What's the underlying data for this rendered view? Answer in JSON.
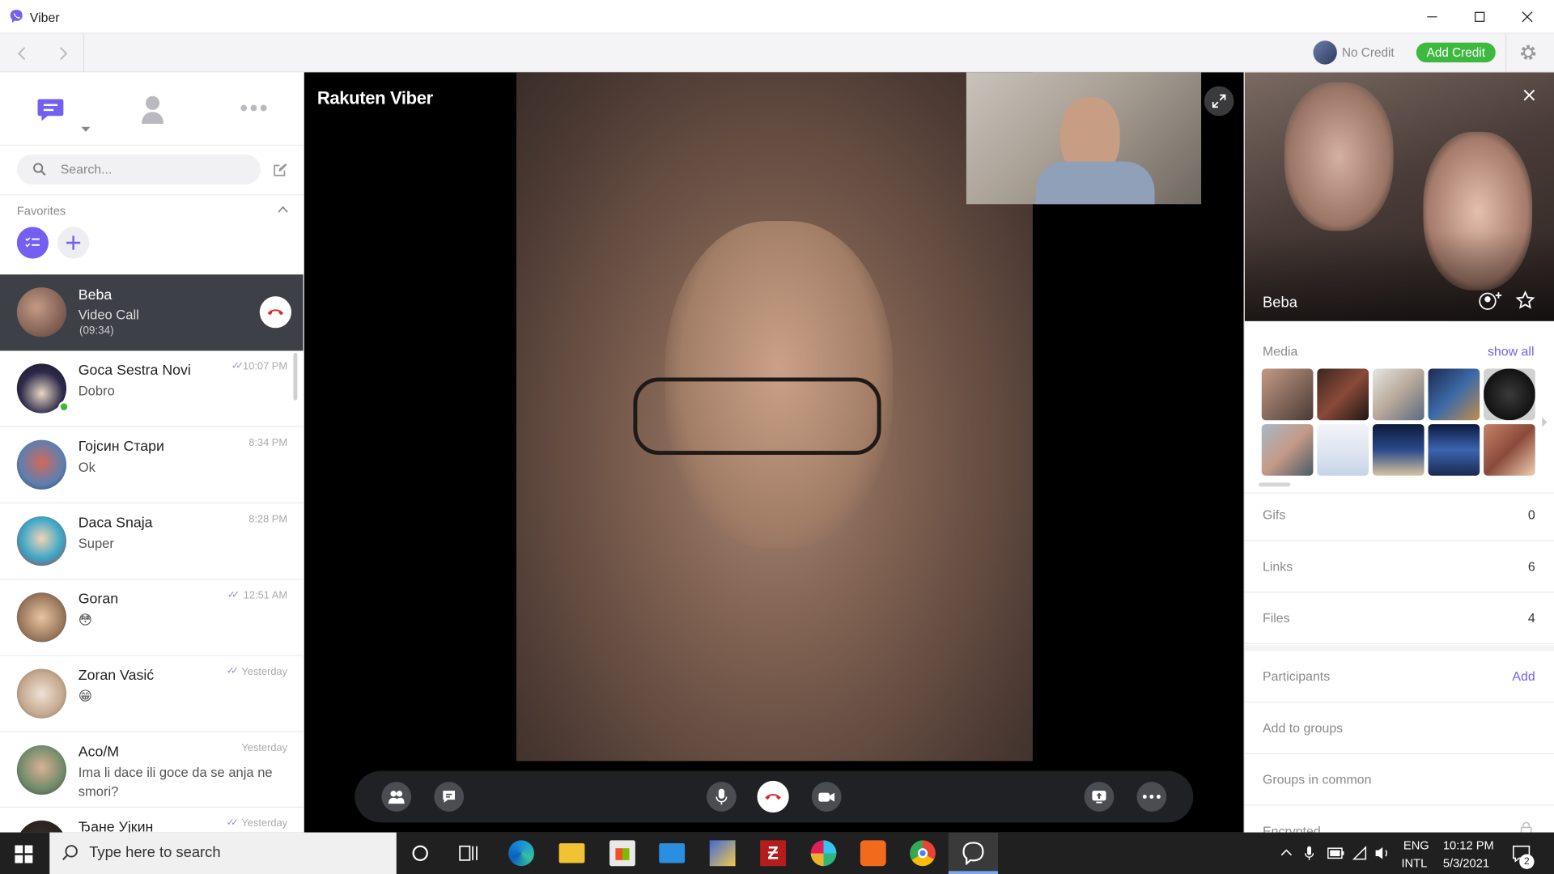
{
  "window": {
    "title": "Viber"
  },
  "toolbar": {
    "credit_status": "No Credit",
    "add_credit_label": "Add Credit"
  },
  "left": {
    "search_placeholder": "Search...",
    "favorites_label": "Favorites",
    "chats": [
      {
        "name": "Beba",
        "msg": "Video Call",
        "msg2": "(09:34)",
        "time": "",
        "active": true
      },
      {
        "name": "Goca Sestra Novi",
        "msg": "Dobro",
        "time": "10:07 PM",
        "online": true,
        "ticks": true
      },
      {
        "name": "Гојсин Стари",
        "msg": "Ok",
        "time": "8:34 PM"
      },
      {
        "name": "Daca Snaja",
        "msg": "Super",
        "time": "8:28 PM"
      },
      {
        "name": "Goran",
        "msg": "😳",
        "time": "12:51 AM",
        "ticks": true
      },
      {
        "name": "Zoran Vasić",
        "msg": "😁",
        "time": "Yesterday",
        "ticks": true
      },
      {
        "name": "Aco/M",
        "msg": "Ima li dace ili goce da se anja ne smori?",
        "time": "Yesterday"
      },
      {
        "name": "Ђане Уjкин",
        "msg": "",
        "time": "Yesterday",
        "ticks": true
      }
    ]
  },
  "call": {
    "brand": "Rakuten Viber"
  },
  "right": {
    "contact_name": "Beba",
    "media_label": "Media",
    "show_all_label": "show all",
    "rows": [
      {
        "label": "Gifs",
        "value": "0"
      },
      {
        "label": "Links",
        "value": "6"
      },
      {
        "label": "Files",
        "value": "4"
      }
    ],
    "participants_label": "Participants",
    "participants_add": "Add",
    "add_to_groups": "Add to groups",
    "groups_in_common": "Groups in common",
    "encrypted_label": "Encrypted"
  },
  "taskbar": {
    "search_placeholder": "Type here to search",
    "lang1": "ENG",
    "lang2": "INTL",
    "time": "10:12 PM",
    "date": "5/3/2021",
    "notifications": "2"
  },
  "colors": {
    "viber_purple": "#7360f2",
    "add_credit_green": "#3eb83f",
    "end_call_red": "#e0262e"
  }
}
